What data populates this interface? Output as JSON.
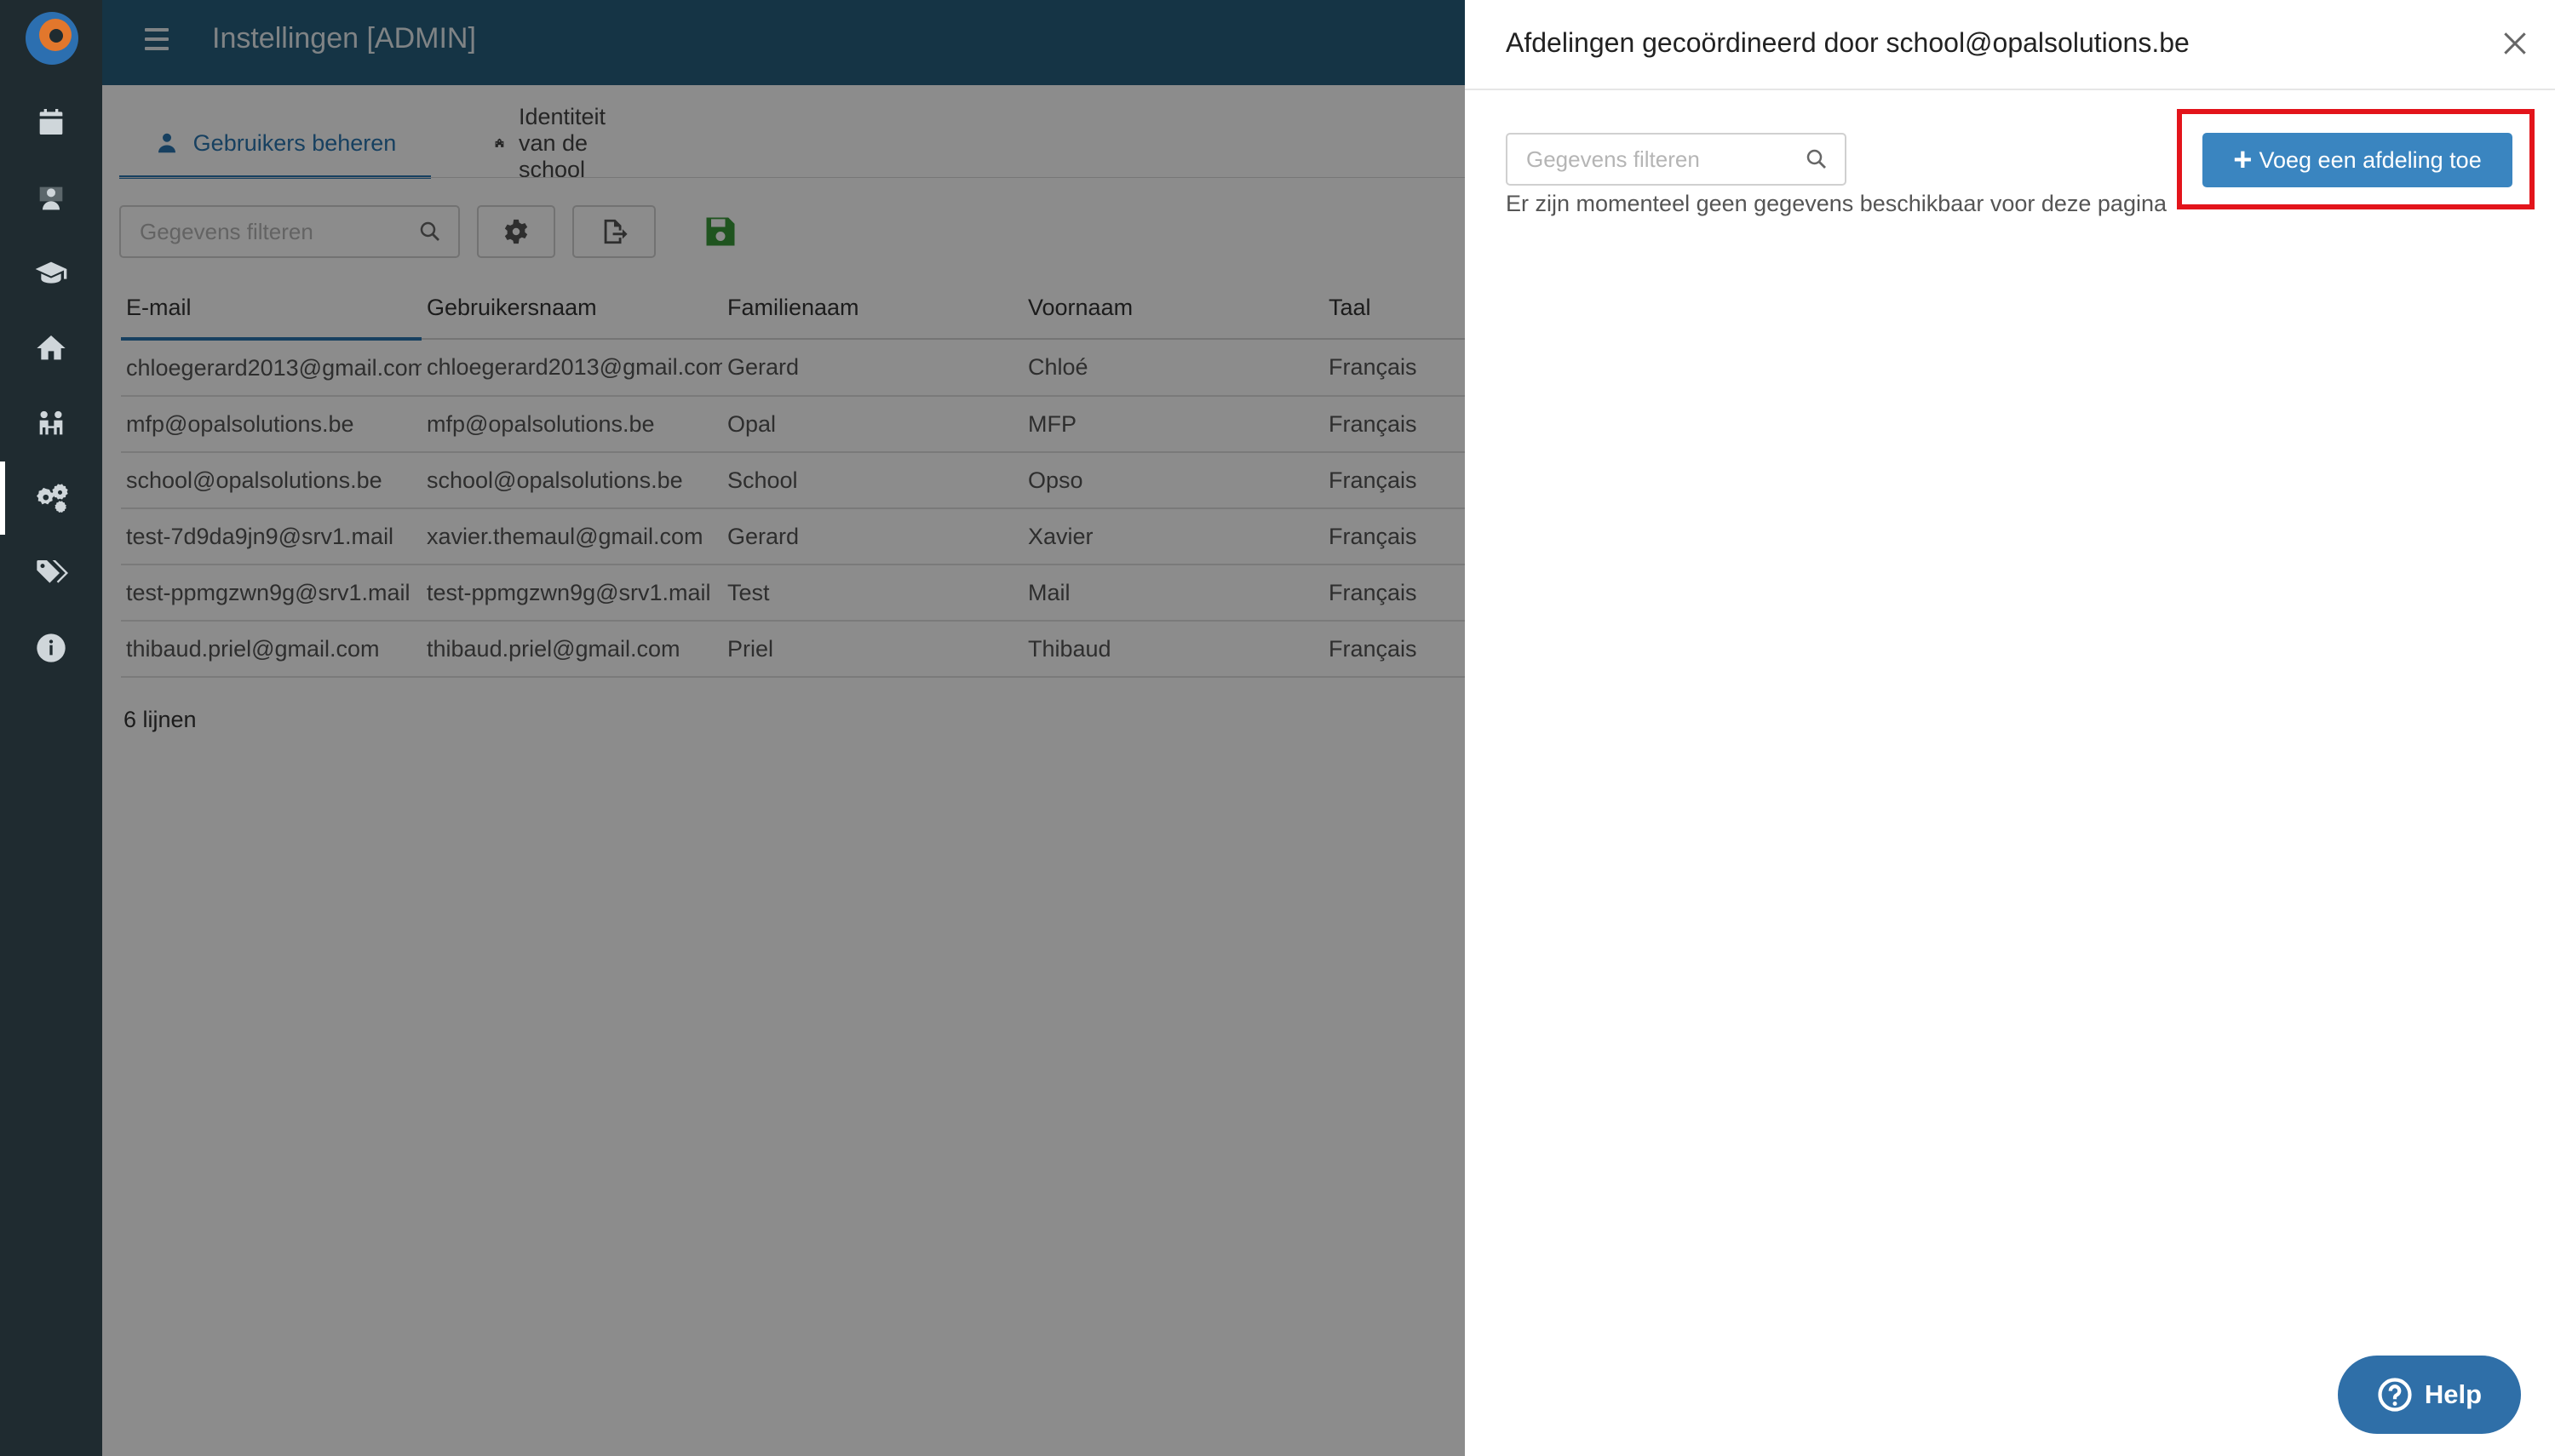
{
  "app": {
    "title": "Instellingen [ADMIN]"
  },
  "sidebar": {
    "logo": "opal-logo",
    "items": [
      {
        "icon": "calendar-icon"
      },
      {
        "icon": "teacher-icon"
      },
      {
        "icon": "graduation-cap-icon"
      },
      {
        "icon": "home-icon"
      },
      {
        "icon": "people-icon"
      },
      {
        "icon": "gears-icon",
        "active": true
      },
      {
        "icon": "tags-icon"
      },
      {
        "icon": "info-icon"
      }
    ]
  },
  "tabs": [
    {
      "label": "Gebruikers beheren",
      "icon": "user-icon",
      "active": true
    },
    {
      "label": "Identiteit van de school",
      "icon": "school-icon",
      "active": false
    }
  ],
  "toolbar": {
    "filter_placeholder": "Gegevens filteren",
    "settings_icon": "gear-icon",
    "export_icon": "export-icon",
    "save_icon": "save-icon"
  },
  "table": {
    "columns": [
      "E-mail",
      "Gebruikersnaam",
      "Familienaam",
      "Voornaam",
      "Taal"
    ],
    "rows": [
      [
        "chloegerard2013@gmail.com",
        "chloegerard2013@gmail.com",
        "Gerard",
        "Chloé",
        "Français"
      ],
      [
        "mfp@opalsolutions.be",
        "mfp@opalsolutions.be",
        "Opal",
        "MFP",
        "Français"
      ],
      [
        "school@opalsolutions.be",
        "school@opalsolutions.be",
        "School",
        "Opso",
        "Français"
      ],
      [
        "test-7d9da9jn9@srv1.mail",
        "xavier.themaul@gmail.com",
        "Gerard",
        "Xavier",
        "Français"
      ],
      [
        "test-ppmgzwn9g@srv1.mail",
        "test-ppmgzwn9g@srv1.mail",
        "Test",
        "Mail",
        "Français"
      ],
      [
        "thibaud.priel@gmail.com",
        "thibaud.priel@gmail.com",
        "Priel",
        "Thibaud",
        "Français"
      ]
    ],
    "row_count": "6 lijnen"
  },
  "drawer": {
    "title": "Afdelingen gecoördineerd door school@opalsolutions.be",
    "filter_placeholder": "Gegevens filteren",
    "empty_message": "Er zijn momenteel geen gegevens beschikbaar voor deze pagina",
    "add_button": "Voeg een afdeling toe",
    "help_button": "Help"
  },
  "colors": {
    "sidebar_bg": "#1f2b30",
    "topbar_bg": "#27607f",
    "accent": "#2a76b0",
    "primary_button": "#3a85c0",
    "highlight": "#e3141b",
    "save_green": "#3a9a3a"
  }
}
